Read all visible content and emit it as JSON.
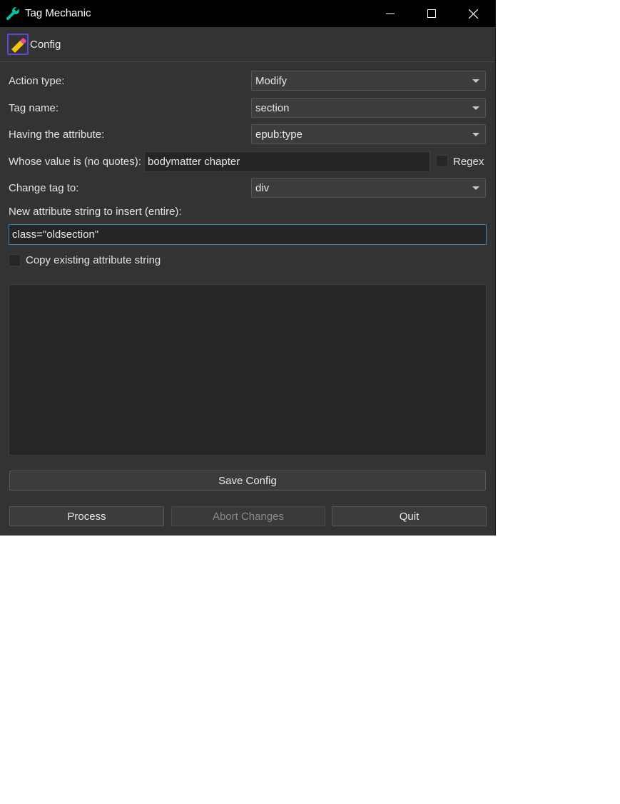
{
  "window": {
    "title": "Tag Mechanic",
    "app_icon": "wrench-icon",
    "accent_color": "#00c4a0"
  },
  "toolbar": {
    "config_label": "Config",
    "config_icon": "pencil-edit-icon"
  },
  "form": {
    "action_type": {
      "label": "Action type:",
      "value": "Modify"
    },
    "tag_name": {
      "label": "Tag name:",
      "value": "section"
    },
    "having_attribute": {
      "label": "Having the attribute:",
      "value": "epub:type"
    },
    "whose_value": {
      "label": "Whose value is (no quotes):",
      "value": "bodymatter chapter"
    },
    "regex": {
      "label": "Regex",
      "checked": false
    },
    "change_tag": {
      "label": "Change tag to:",
      "value": "div"
    },
    "new_attribute": {
      "label": "New attribute string to insert (entire):",
      "value": "class=\"oldsection\""
    },
    "copy_existing": {
      "label": "Copy existing attribute string",
      "checked": false
    }
  },
  "buttons": {
    "save_config": "Save Config",
    "process": "Process",
    "abort_changes": "Abort Changes",
    "quit": "Quit"
  }
}
